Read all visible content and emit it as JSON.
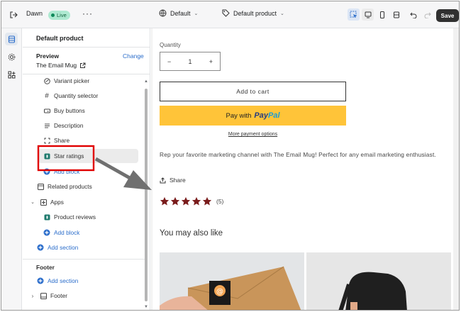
{
  "topbar": {
    "theme_name": "Dawn",
    "live_badge": "Live",
    "more_label": "···",
    "template_label": "Default",
    "product_label": "Default product",
    "save_label": "Save"
  },
  "panel": {
    "title": "Default product",
    "preview_label": "Preview",
    "change_label": "Change",
    "preview_value": "The Email Mug",
    "items": [
      {
        "label": "Variant picker",
        "icon": "variant-picker-icon"
      },
      {
        "label": "Quantity selector",
        "icon": "hash-icon"
      },
      {
        "label": "Buy buttons",
        "icon": "buy-buttons-icon"
      },
      {
        "label": "Description",
        "icon": "text-lines-icon"
      },
      {
        "label": "Share",
        "icon": "share-frame-icon"
      },
      {
        "label": "Star ratings",
        "icon": "app-block-icon"
      },
      {
        "label": "Add block",
        "icon": "plus-circle-icon"
      },
      {
        "label": "Related products",
        "icon": "section-icon"
      },
      {
        "label": "Apps",
        "icon": "apps-icon"
      },
      {
        "label": "Product reviews",
        "icon": "app-block-icon"
      },
      {
        "label": "Add block",
        "icon": "plus-circle-icon"
      },
      {
        "label": "Add section",
        "icon": "plus-circle-icon"
      }
    ],
    "footer_label": "Footer",
    "footer_add_section": "Add section",
    "footer_item": "Footer"
  },
  "preview": {
    "quantity_label": "Quantity",
    "quantity_value": "1",
    "minus": "−",
    "plus": "+",
    "add_to_cart": "Add to cart",
    "paypal_prefix": "Pay with",
    "paypal_brand_1": "Pay",
    "paypal_brand_2": "Pal",
    "more_payment": "More payment options",
    "description": "Rep your favorite marketing channel with The Email Mug! Perfect for any email marketing enthusiast.",
    "share_label": "Share",
    "rating_count": "(5)",
    "rating_stars": 5,
    "you_may_also_like": "You may also like"
  },
  "colors": {
    "star": "#7a1c1c",
    "highlight_box": "#e00000",
    "arrow": "#707070",
    "paypal_yellow": "#ffc439",
    "link_blue": "#2c6ecb"
  }
}
